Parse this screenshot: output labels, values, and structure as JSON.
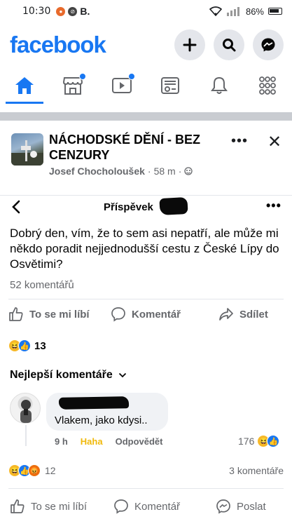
{
  "status_bar": {
    "time": "10:30",
    "carrier": "B.",
    "battery": "86%"
  },
  "header": {
    "logo": "facebook"
  },
  "tabs": [
    {
      "name": "home",
      "active": true,
      "badge": false
    },
    {
      "name": "marketplace",
      "active": false,
      "badge": true
    },
    {
      "name": "video",
      "active": false,
      "badge": true
    },
    {
      "name": "feeds",
      "active": false,
      "badge": false
    },
    {
      "name": "notifications",
      "active": false,
      "badge": false
    },
    {
      "name": "menu",
      "active": false,
      "badge": false
    }
  ],
  "group": {
    "name": "NÁCHODSKÉ DĚNÍ - BEZ CENZURY",
    "author": "Josef Chocholoušek",
    "time": "58 m",
    "more": "•••",
    "close": "✕"
  },
  "post_bar": {
    "title": "Příspěvek",
    "more": "•••"
  },
  "post": {
    "text": "Dobrý den, vím, že to sem asi nepatří, ale může mi někdo poradit nejjednodušší cestu z České Lípy do Osvětimi?",
    "comment_count": "52 komentářů"
  },
  "actions": {
    "like": "To se mi líbí",
    "comment": "Komentář",
    "share": "Sdílet"
  },
  "reactions": {
    "count": "13"
  },
  "top_comments_label": "Nejlepší komentáře",
  "comment": {
    "text": "Vlakem, jako kdysi..",
    "time": "9 h",
    "reaction_label": "Haha",
    "reply_label": "Odpovědět",
    "reaction_count": "176"
  },
  "comment_summary": {
    "count": "12",
    "replies": "3 komentáře"
  },
  "bottom_actions": {
    "like": "To se mi líbí",
    "comment": "Komentář",
    "message": "Poslat"
  },
  "colors": {
    "accent": "#1877f2",
    "text": "#050505",
    "muted": "#65676b",
    "haha": "#f7b928"
  }
}
